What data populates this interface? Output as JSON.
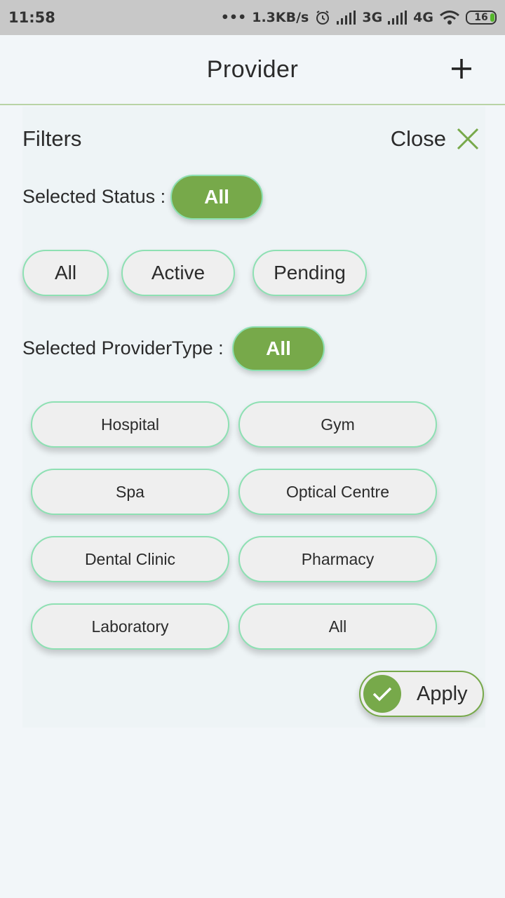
{
  "status_bar": {
    "time": "11:58",
    "speed": "1.3KB/s",
    "net1": "3G",
    "net2": "4G",
    "battery": "16"
  },
  "appbar": {
    "title": "Provider",
    "add_icon": "plus-icon"
  },
  "filters": {
    "title": "Filters",
    "close_label": "Close",
    "close_icon": "close-x-icon",
    "status_label": "Selected Status :",
    "status_selected": "All",
    "status_options": [
      "All",
      "Active",
      "Pending"
    ],
    "ptype_label": "Selected ProviderType :",
    "ptype_selected": "All",
    "ptype_options": [
      "Hospital",
      "Gym",
      "Spa",
      "Optical Centre",
      "Dental Clinic",
      "Pharmacy",
      "Laboratory",
      "All"
    ],
    "apply_label": "Apply",
    "apply_icon": "check-icon"
  },
  "colors": {
    "accent": "#77a94a",
    "pill_border": "#8ee0b3",
    "pill_bg": "#efefef"
  }
}
